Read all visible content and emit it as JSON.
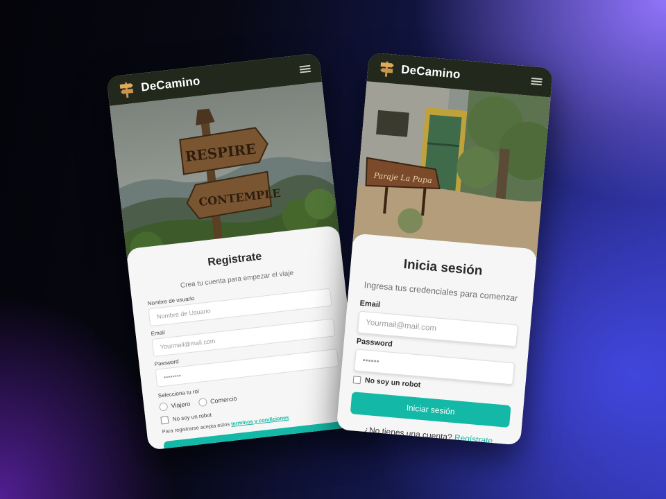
{
  "colors": {
    "accent": "#14b8a6",
    "appbar": "#23281c",
    "card": "#f5f6f5"
  },
  "register_screen": {
    "brand": "DeCamino",
    "hero_signs": [
      "RESPIRE",
      "CONTEMPLE"
    ],
    "title": "Registrate",
    "subtitle": "Crea tu cuenta para empezar el viaje",
    "username": {
      "label": "Nombre de usuario",
      "placeholder": "Nombre de Usuario"
    },
    "email": {
      "label": "Email",
      "placeholder": "Yourmail@mail.com"
    },
    "password": {
      "label": "Password",
      "placeholder": "••••••••"
    },
    "role": {
      "label": "Selecciona tu rol",
      "options": [
        "Viajero",
        "Comercio"
      ]
    },
    "robot_label": "No soy un robot",
    "terms_prefix": "Para registrarse acepta estos",
    "terms_link": "terminos y condiciones",
    "icons": [
      "signpost-logo-icon",
      "hamburger-menu-icon"
    ]
  },
  "login_screen": {
    "brand": "DeCamino",
    "hero_sign": "Paraje La Pupa",
    "title": "Inicia sesión",
    "subtitle": "Ingresa tus credenciales para comenzar",
    "email": {
      "label": "Email",
      "placeholder": "Yourmail@mail.com"
    },
    "password": {
      "label": "Password",
      "placeholder": "••••••"
    },
    "robot_label": "No soy un robot",
    "submit_label": "Iniciar sesión",
    "no_account_text": "¿No tienes una cuenta?",
    "register_link": "Regístrate",
    "icons": [
      "signpost-logo-icon",
      "hamburger-menu-icon"
    ]
  }
}
